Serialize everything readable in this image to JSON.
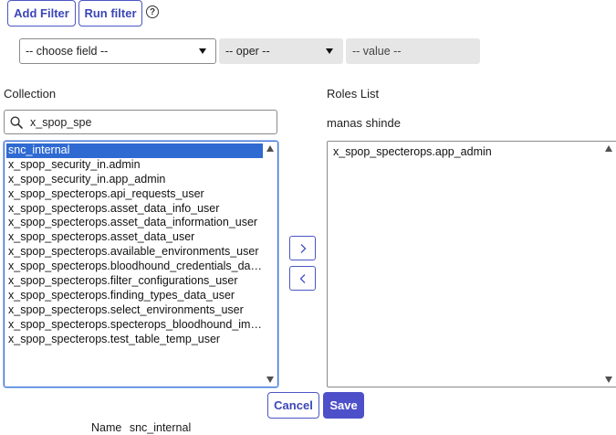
{
  "toolbar": {
    "add_filter_label": "Add Filter",
    "run_filter_label": "Run filter",
    "help_glyph": "?"
  },
  "filter": {
    "field_value": "-- choose field --",
    "oper_value": "-- oper --",
    "value_placeholder": "-- value --"
  },
  "collection": {
    "label": "Collection",
    "search_value": "x_spop_spe",
    "items": [
      "snc_internal",
      "x_spop_security_in.admin",
      "x_spop_security_in.app_admin",
      "x_spop_specterops.api_requests_user",
      "x_spop_specterops.asset_data_info_user",
      "x_spop_specterops.asset_data_information_user",
      "x_spop_specterops.asset_data_user",
      "x_spop_specterops.available_environments_user",
      "x_spop_specterops.bloodhound_credentials_data_user",
      "x_spop_specterops.filter_configurations_user",
      "x_spop_specterops.finding_types_data_user",
      "x_spop_specterops.select_environments_user",
      "x_spop_specterops.specterops_bloodhound_import_user",
      "x_spop_specterops.test_table_temp_user"
    ],
    "selected_index": 0
  },
  "roles": {
    "label": "Roles List",
    "owner": "manas shinde",
    "items": [
      "x_spop_specterops.app_admin"
    ]
  },
  "actions": {
    "cancel_label": "Cancel",
    "save_label": "Save"
  },
  "footer": {
    "name_label": "Name",
    "name_value": "snc_internal"
  },
  "colors": {
    "accent": "#4b56c4",
    "selection": "#2f6ad3",
    "save_bg": "#4d50c8"
  }
}
